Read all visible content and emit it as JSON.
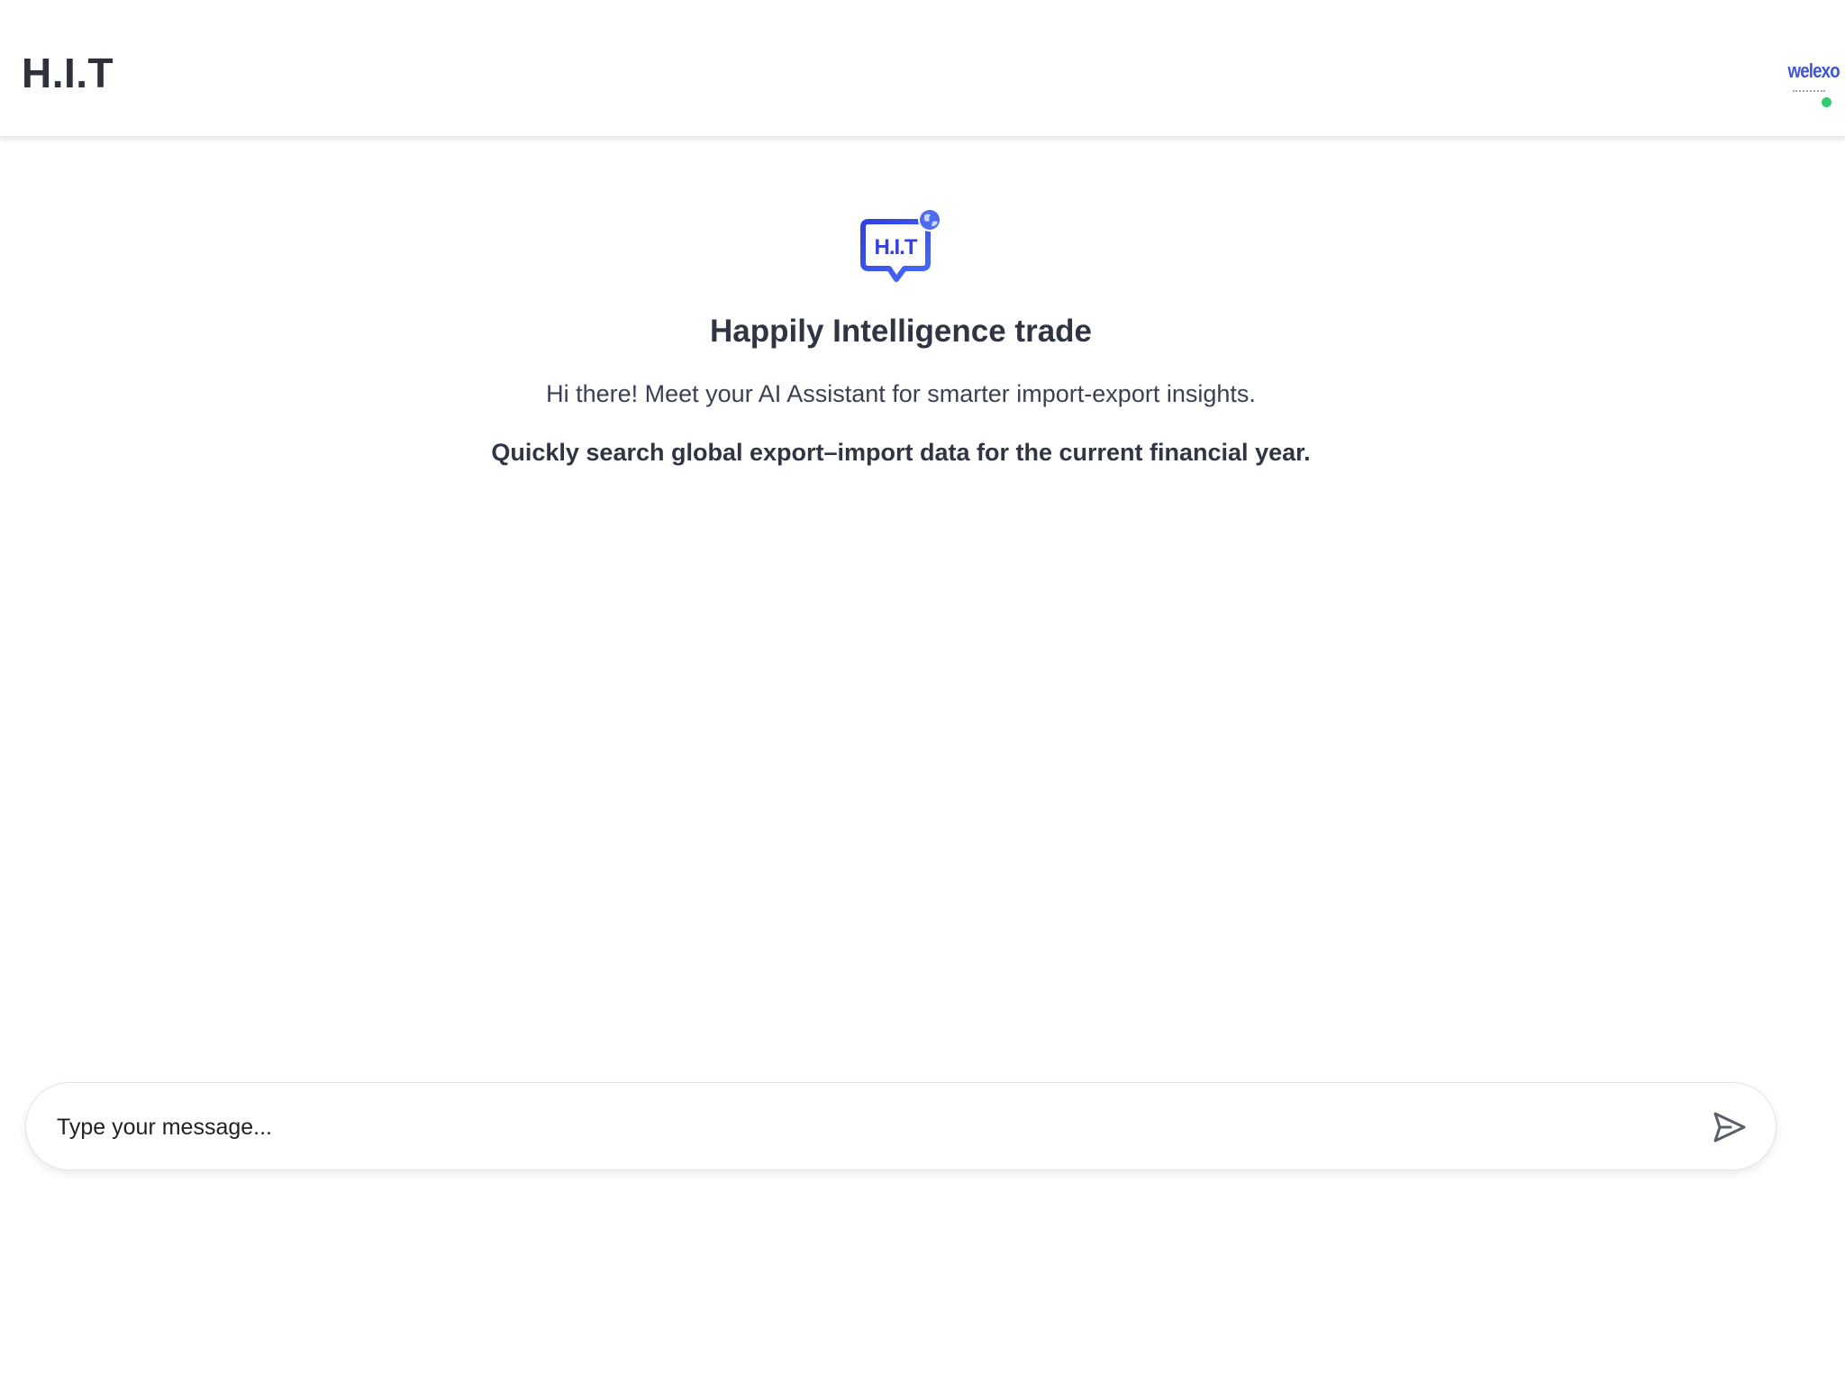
{
  "header": {
    "title": "H.I.T",
    "avatar_wordmark": "welexo",
    "status_color": "#2ecc71"
  },
  "hero": {
    "logo_text": "H.I.T",
    "logo_icon": "chat-bubble-globe-icon",
    "title": "Happily Intelligence trade",
    "subtitle": "Hi there! Meet your AI Assistant for smarter import-export insights.",
    "tagline": "Quickly search global export–import data for the current financial year."
  },
  "composer": {
    "placeholder": "Type your message...",
    "value": "",
    "send_icon": "send-icon"
  },
  "colors": {
    "brand_blue": "#3d46e0",
    "text_dark": "#2f3543",
    "online_green": "#2ecc71"
  }
}
